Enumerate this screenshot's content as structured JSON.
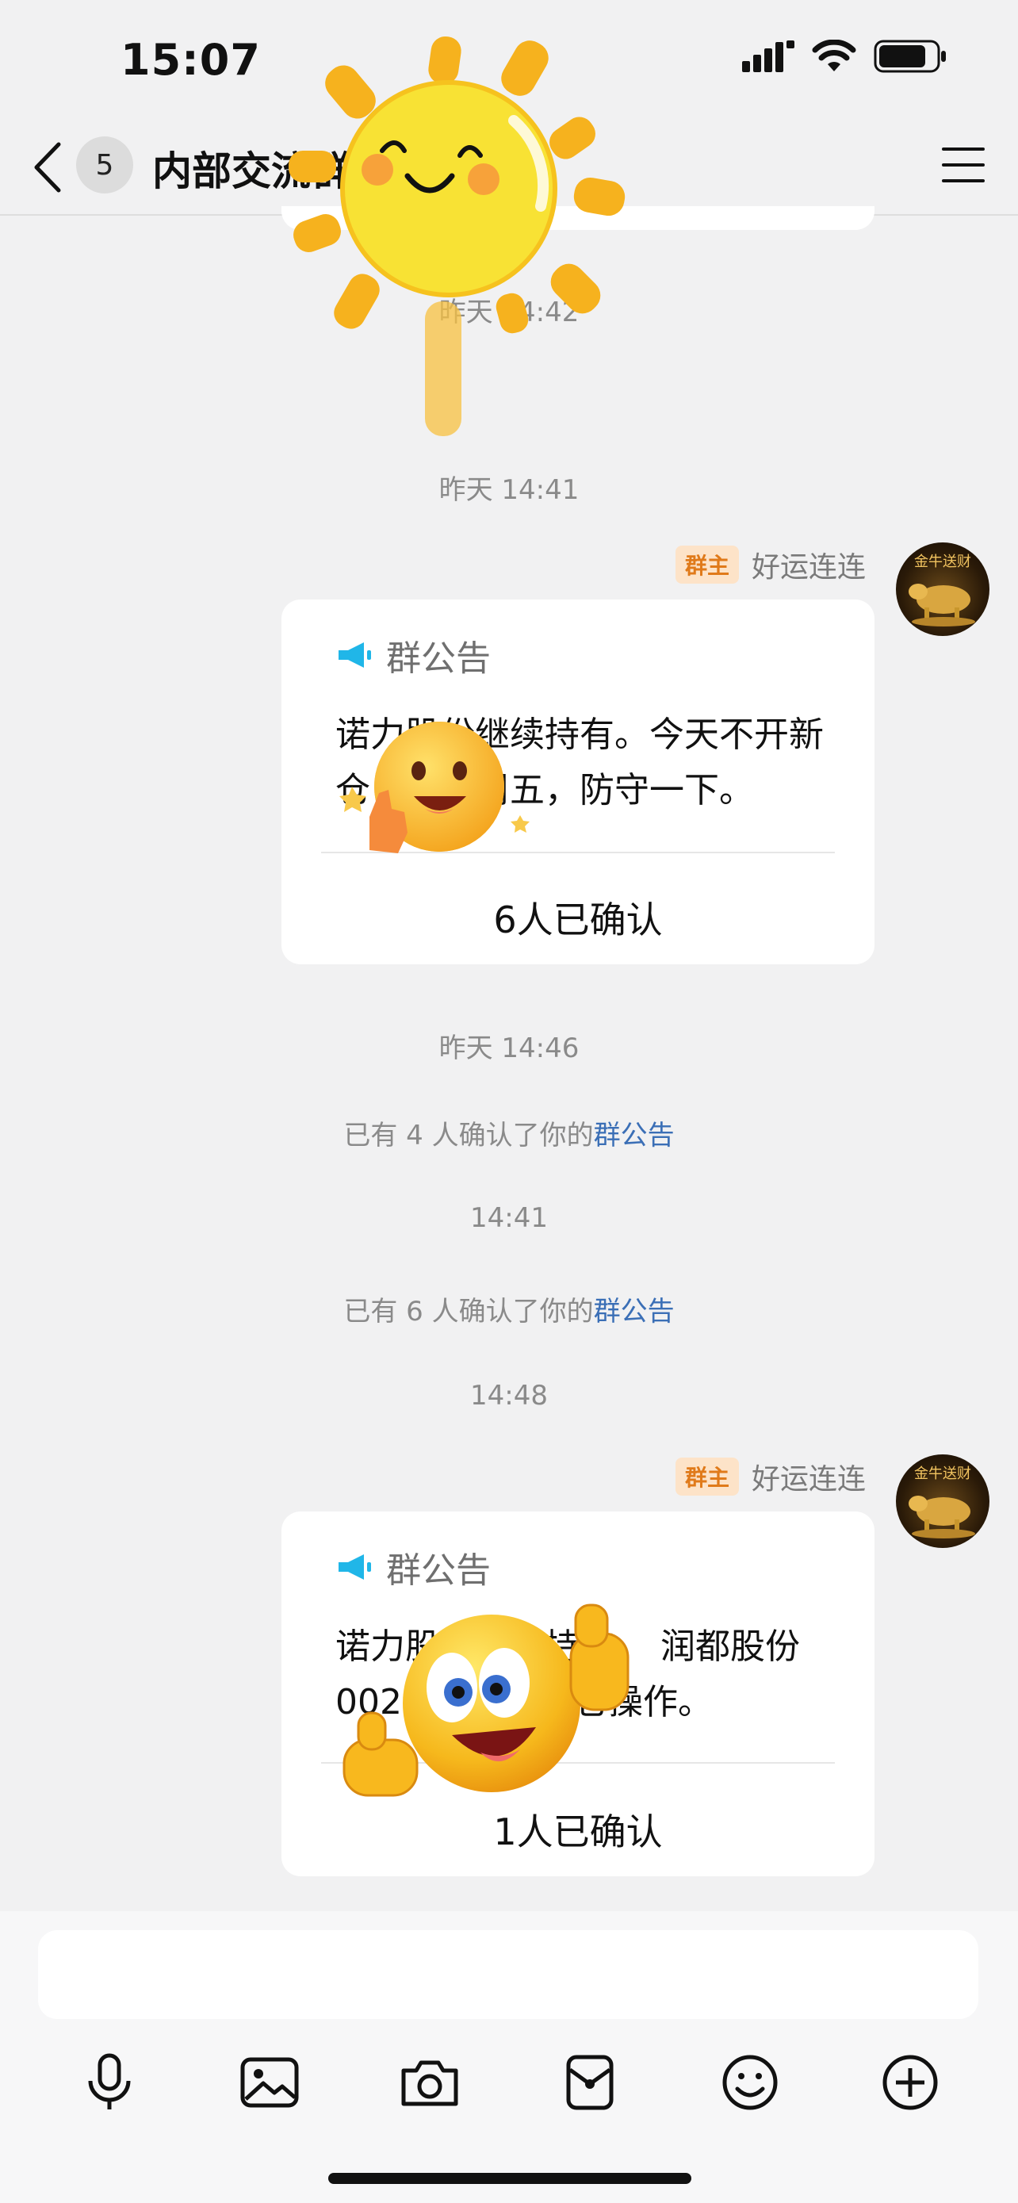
{
  "status": {
    "time": "15:07"
  },
  "header": {
    "unread_count": "5",
    "title": "内部交流群"
  },
  "timestamps": {
    "t1": "昨天 14:42",
    "t2": "昨天 14:41",
    "t3": "昨天 14:46",
    "t4": "14:41",
    "t5": "14:48"
  },
  "messages": [
    {
      "owner_tag": "群主",
      "sender": "好运连连",
      "avatar_text": "金牛送财",
      "card_title": "群公告",
      "body": "诺力股份继续持有。今天不开新仓，今天周五，防守一下。",
      "confirm": "6人已确认"
    },
    {
      "owner_tag": "群主",
      "sender": "好运连连",
      "avatar_text": "金牛送财",
      "card_title": "群公告",
      "body": "诺力股份继续持有， 润都股份002923仓位减仓操作。",
      "confirm": "1人已确认"
    }
  ],
  "system": [
    {
      "prefix": "已有 4 人确认了你的",
      "link": "群公告"
    },
    {
      "prefix": "已有 6 人确认了你的",
      "link": "群公告"
    }
  ],
  "toolbar": {
    "icons": [
      "microphone-icon",
      "image-icon",
      "camera-icon",
      "red-packet-icon",
      "emoji-icon",
      "plus-icon"
    ]
  },
  "colors": {
    "link": "#3b6fb6",
    "owner_tag_bg": "#fde3c8",
    "owner_tag_fg": "#e07a1a",
    "announce_icon": "#20b6e8"
  }
}
